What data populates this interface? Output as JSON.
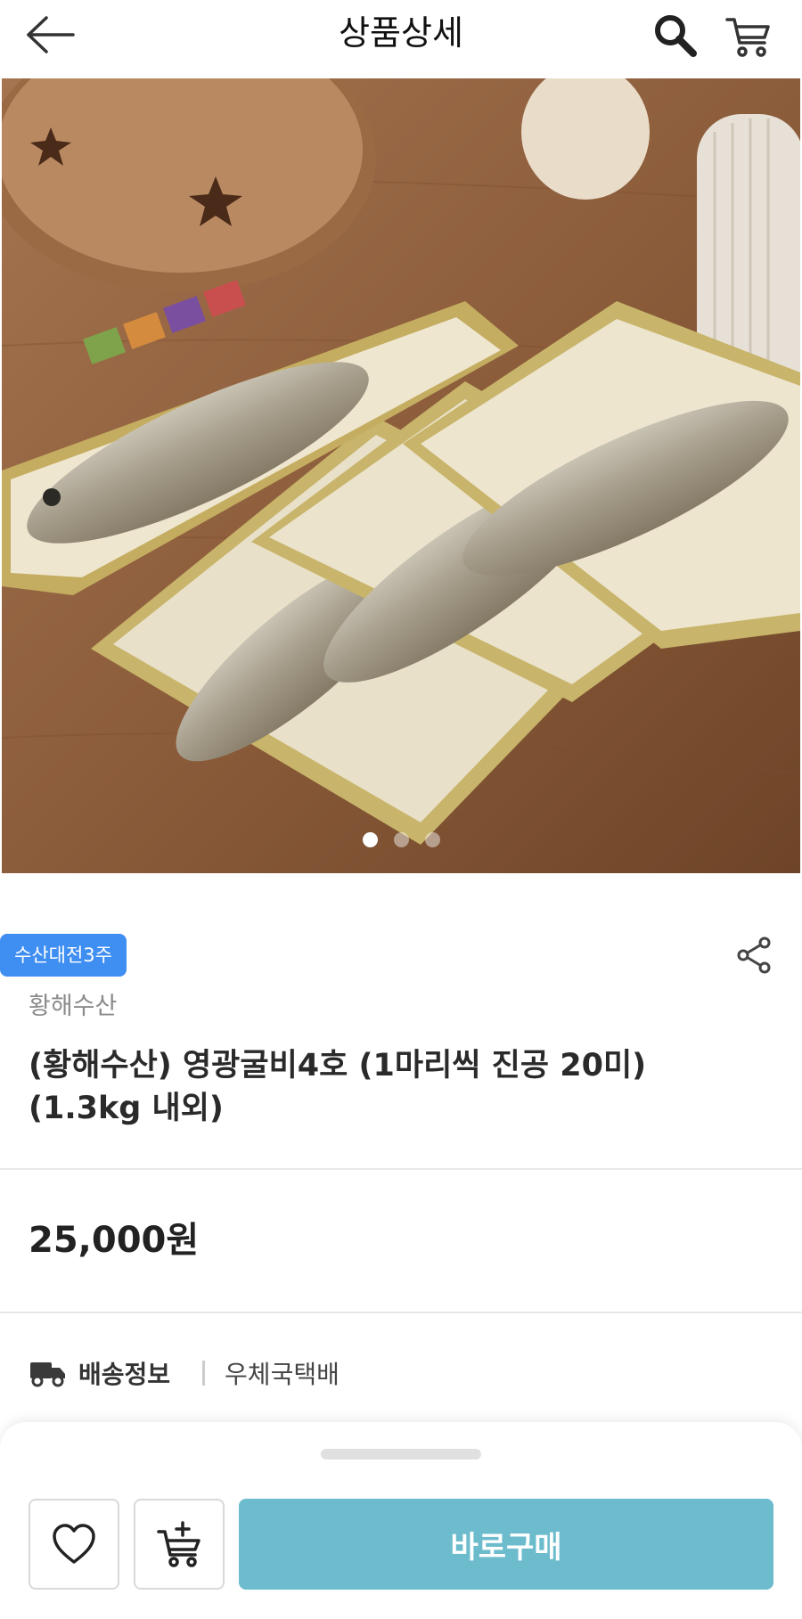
{
  "header": {
    "title": "상품상세",
    "back_icon": "arrow-left-icon",
    "search_icon": "search-icon",
    "cart_icon": "cart-icon"
  },
  "gallery": {
    "image_description_icon": "product-photo",
    "total_images": 3,
    "active_index": 0
  },
  "product": {
    "badge": "수산대전3주",
    "brand": "황해수산",
    "name": "(황해수산) 영광굴비4호 (1마리씩 진공 20미) (1.3kg 내외)",
    "price": "25,000원"
  },
  "delivery": {
    "label": "배송정보",
    "value": "우체국택배"
  },
  "actions": {
    "buy_label": "바로구매"
  },
  "colors": {
    "badge": "#3f8ef2",
    "buy_button": "#6cbccd"
  }
}
